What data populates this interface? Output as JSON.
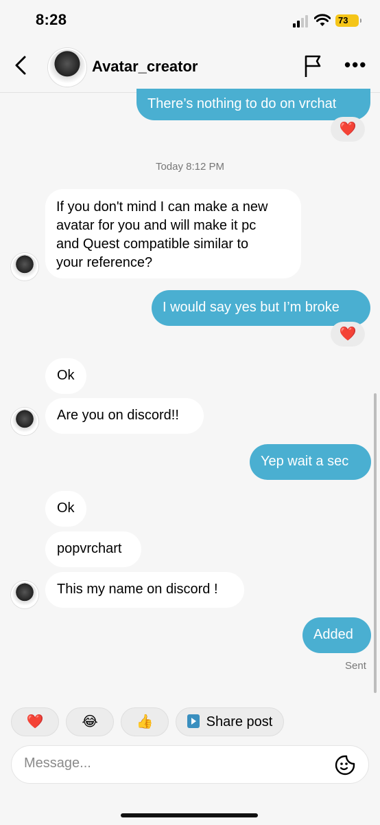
{
  "status": {
    "time": "8:28",
    "battery": "73"
  },
  "header": {
    "contact_name": "Avatar_creator"
  },
  "messages": {
    "m1": "There’s nothing to do on vrchat",
    "divider": "Today 8:12 PM",
    "m2_lines": [
      "If you don't mind I can make a new",
      "avatar for you and will make it pc",
      "and Quest compatible similar to",
      "your reference?"
    ],
    "m3": "I would say yes but I’m broke",
    "m4": "Ok",
    "m5": "Are you on discord!!",
    "m6": "Yep wait a sec",
    "m7": "Ok",
    "m8": "popvrchart",
    "m9": "This my name on discord !",
    "m10": "Added",
    "sent": "Sent"
  },
  "reactions": {
    "heart": "❤️"
  },
  "quick_replies": {
    "heart": "❤️",
    "laugh": "😂",
    "thumbs": "👍",
    "share_post": "Share post"
  },
  "composer": {
    "placeholder": "Message..."
  },
  "colors": {
    "outgoing": "#4aafd1",
    "incoming": "#ffffff",
    "battery": "#f5c518"
  },
  "icons": [
    "back-chevron-icon",
    "flag-icon",
    "more-icon",
    "sticker-icon",
    "signal-icon",
    "wifi-icon"
  ]
}
